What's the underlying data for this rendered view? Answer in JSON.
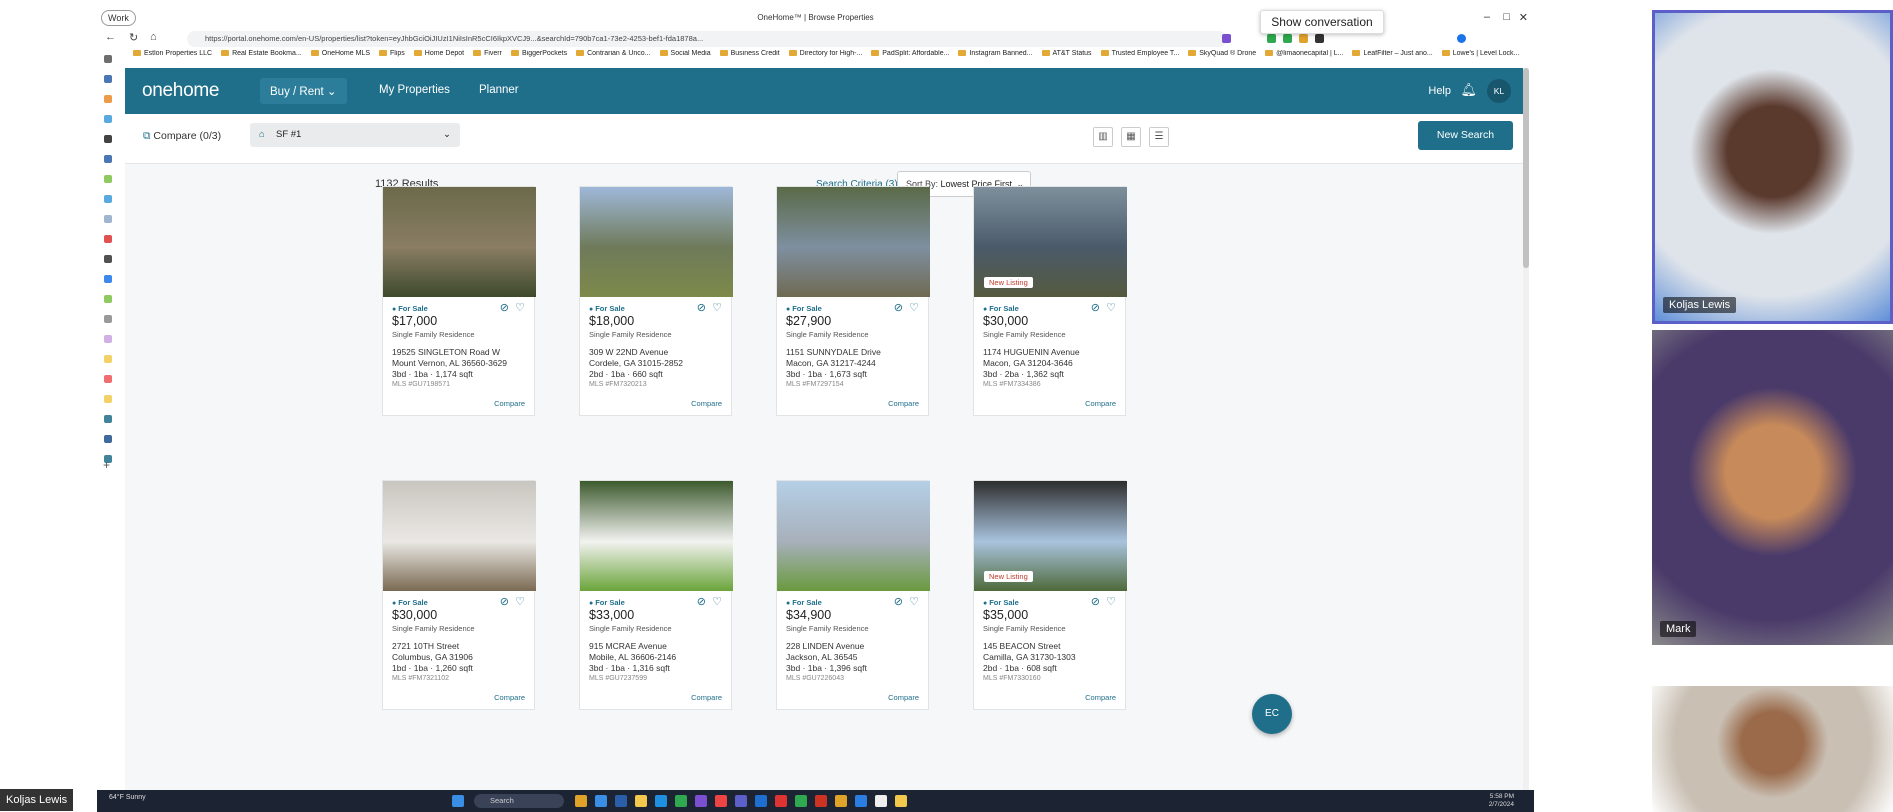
{
  "window": {
    "work_label": "Work",
    "tab_title": "OneHome™ | Browse Properties",
    "show_conversation": "Show conversation",
    "url": "https://portal.onehome.com/en-US/properties/list?token=eyJhbGciOiJIUzI1NiIsInR5cCI6IkpXVCJ9...&searchId=790b7ca1-73e2-4253-bef1-fda1878a..."
  },
  "bookmarks": [
    "Estlon Properties LLC",
    "Real Estate Bookma...",
    "OneHome MLS",
    "Flips",
    "Home Depot",
    "Fiverr",
    "BiggerPockets",
    "Contrarian & Unco...",
    "Social Media",
    "Business Credit",
    "Directory for High-...",
    "PadSplit: Affordable...",
    "Instagram Banned...",
    "AT&T Status",
    "Trusted Employee T...",
    "SkyQuad ® Drone",
    "@limaonecapital | L...",
    "LeafFilter – Just ano...",
    "Lowe's | Level Lock..."
  ],
  "nav": {
    "logo": "onehome",
    "buy_rent": "Buy / Rent",
    "my_properties": "My Properties",
    "planner": "Planner",
    "help": "Help",
    "avatar": "KL"
  },
  "toolbar": {
    "compare": "Compare (0/3)",
    "saved_search": "SF #1",
    "new_search": "New Search"
  },
  "results": {
    "count": "1132 Results",
    "criteria": "Search Criteria (3)",
    "sort_prefix": "Sort By:",
    "sort_value": "Lowest Price First"
  },
  "listings": [
    {
      "status": "For Sale",
      "price": "$17,000",
      "type": "Single Family Residence",
      "addr1": "19525 SINGLETON Road W",
      "addr2": "Mount Vernon, AL 36560-3629",
      "specs": "3bd · 1ba · 1,174 sqft",
      "mls": "MLS #GU7198571",
      "compare": "Compare",
      "badge": "",
      "photo": [
        "#6b6a4a",
        "#8a7d64",
        "#3e4a2c"
      ]
    },
    {
      "status": "For Sale",
      "price": "$18,000",
      "type": "Single Family Residence",
      "addr1": "309 W 22ND Avenue",
      "addr2": "Cordele, GA 31015-2852",
      "specs": "2bd · 1ba · 660 sqft",
      "mls": "MLS #FM7320213",
      "compare": "Compare",
      "badge": "",
      "photo": [
        "#9fb8d9",
        "#6f7a5a",
        "#7c8a4a"
      ]
    },
    {
      "status": "For Sale",
      "price": "$27,900",
      "type": "Single Family Residence",
      "addr1": "1151 SUNNYDALE Drive",
      "addr2": "Macon, GA 31217-4244",
      "specs": "3bd · 1ba · 1,673 sqft",
      "mls": "MLS #FM7297154",
      "compare": "Compare",
      "badge": "",
      "photo": [
        "#5a6a48",
        "#7e8fa0",
        "#6f6a52"
      ]
    },
    {
      "status": "For Sale",
      "price": "$30,000",
      "type": "Single Family Residence",
      "addr1": "1174 HUGUENIN Avenue",
      "addr2": "Macon, GA 31204-3646",
      "specs": "3bd · 2ba · 1,362 sqft",
      "mls": "MLS #FM7334386",
      "compare": "Compare",
      "badge": "New Listing",
      "photo": [
        "#7e8f9c",
        "#4a5a6a",
        "#555a3e"
      ]
    },
    {
      "status": "For Sale",
      "price": "$30,000",
      "type": "Single Family Residence",
      "addr1": "2721 10TH Street",
      "addr2": "Columbus, GA 31906",
      "specs": "1bd · 1ba · 1,260 sqft",
      "mls": "MLS #FM7321102",
      "compare": "Compare",
      "badge": "",
      "photo": [
        "#c9c6c0",
        "#eae8e4",
        "#7a6a52"
      ]
    },
    {
      "status": "For Sale",
      "price": "$33,000",
      "type": "Single Family Residence",
      "addr1": "915 MCRAE Avenue",
      "addr2": "Mobile, AL 36606-2146",
      "specs": "3bd · 1ba · 1,316 sqft",
      "mls": "MLS #GU7237599",
      "compare": "Compare",
      "badge": "",
      "photo": [
        "#3d5a2e",
        "#f2f2f0",
        "#6aa43a"
      ]
    },
    {
      "status": "For Sale",
      "price": "$34,900",
      "type": "Single Family Residence",
      "addr1": "228 LINDEN Avenue",
      "addr2": "Jackson, AL 36545",
      "specs": "3bd · 1ba · 1,396 sqft",
      "mls": "MLS #GU7226043",
      "compare": "Compare",
      "badge": "",
      "photo": [
        "#b5cfe6",
        "#a7b0bb",
        "#6a9a3e"
      ]
    },
    {
      "status": "For Sale",
      "price": "$35,000",
      "type": "Single Family Residence",
      "addr1": "145 BEACON Street",
      "addr2": "Camilla, GA 31730-1303",
      "specs": "2bd · 1ba · 608 sqft",
      "mls": "MLS #FM7330160",
      "compare": "Compare",
      "badge": "New Listing",
      "photo": [
        "#2e2e2e",
        "#a9c3de",
        "#4e6a3a"
      ]
    }
  ],
  "chat_button": "EC",
  "taskbar": {
    "weather_temp": "64°F",
    "weather_desc": "Sunny",
    "search": "Search",
    "time": "5:58 PM",
    "date": "2/7/2024"
  },
  "speaker_label": "Koljas Lewis",
  "participants": [
    {
      "name": "Koljas Lewis",
      "bg": [
        "#dfe4ea",
        "#5b3a2e",
        "#5f8fd8"
      ]
    },
    {
      "name": "Mark",
      "bg": [
        "#4a3a6a",
        "#c78a5a",
        "#8a8a8a"
      ]
    },
    {
      "name": "",
      "bg": [
        "#c9bfb3",
        "#9a6a4a",
        "#ffffff"
      ]
    }
  ],
  "colors": {
    "brand": "#1f6f8b",
    "accent_dark": "#17566d"
  }
}
